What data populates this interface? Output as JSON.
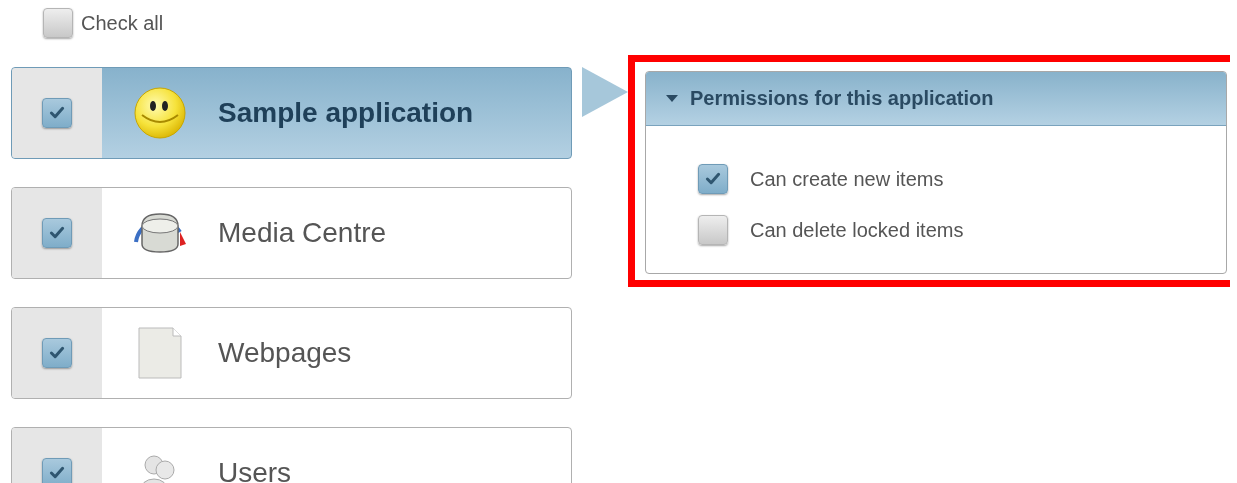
{
  "check_all": {
    "label": "Check all",
    "checked": false
  },
  "applications": [
    {
      "name": "Sample application",
      "kind": "smiley",
      "checked": true,
      "selected": true
    },
    {
      "name": "Media Centre",
      "kind": "knob",
      "checked": true,
      "selected": false
    },
    {
      "name": "Webpages",
      "kind": "page",
      "checked": true,
      "selected": false
    },
    {
      "name": "Users",
      "kind": "users",
      "checked": true,
      "selected": false
    }
  ],
  "permissions_panel": {
    "title": "Permissions for this application",
    "expanded": true,
    "items": [
      {
        "label": "Can create new items",
        "checked": true
      },
      {
        "label": "Can delete locked items",
        "checked": false
      }
    ]
  }
}
